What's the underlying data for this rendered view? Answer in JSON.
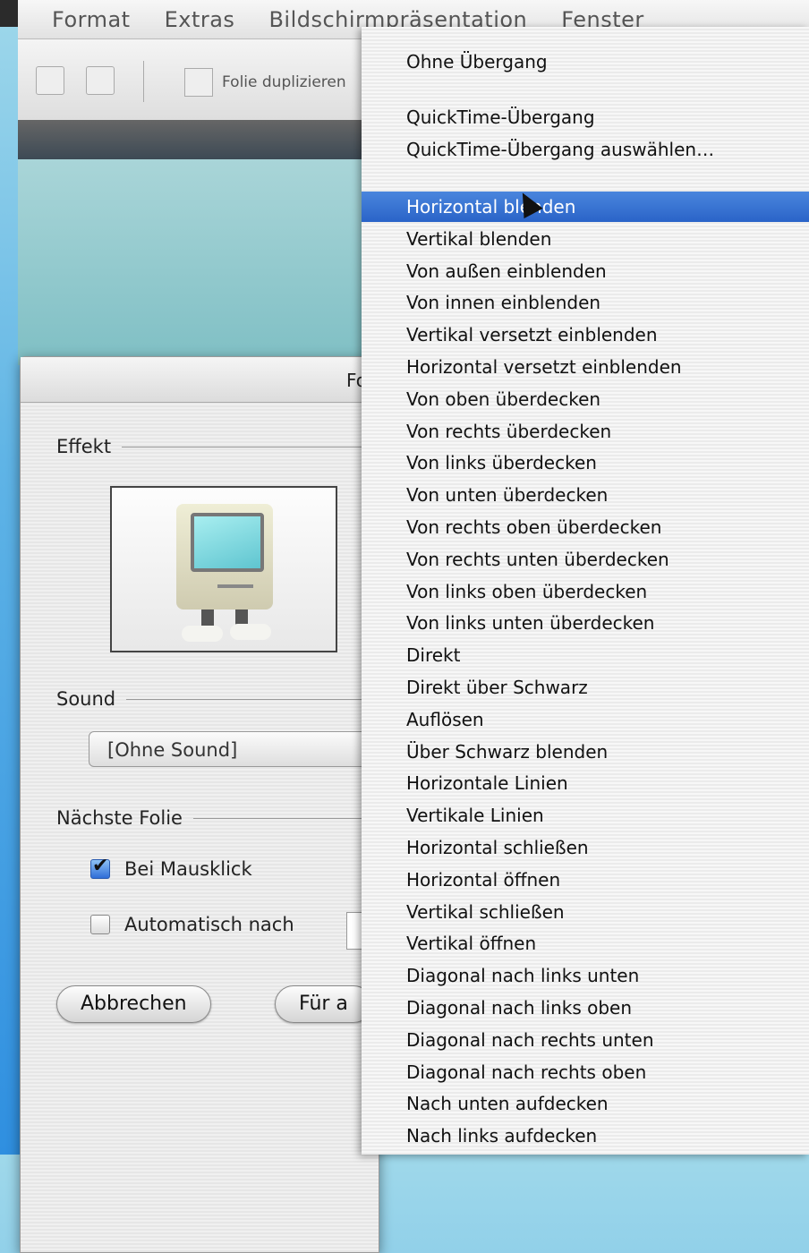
{
  "menubar": {
    "items": [
      "Format",
      "Extras",
      "Bildschirmpräsentation",
      "Fenster"
    ]
  },
  "toolbar": {
    "duplicate_label": "Folie duplizieren"
  },
  "dialog": {
    "title": "Fo",
    "effect_label": "Effekt",
    "sound_label": "Sound",
    "sound_value": "[Ohne Sound]",
    "next_slide_label": "Nächste Folie",
    "on_click_label": "Bei Mausklick",
    "on_click_checked": true,
    "auto_label": "Automatisch nach",
    "auto_checked": false,
    "cancel_label": "Abbrechen",
    "apply_label": "Für a"
  },
  "menu": {
    "items": [
      "Ohne Übergang",
      "QuickTime-Übergang",
      "QuickTime-Übergang auswählen…",
      "Horizontal blenden",
      "Vertikal blenden",
      "Von außen einblenden",
      "Von innen einblenden",
      "Vertikal versetzt einblenden",
      "Horizontal versetzt einblenden",
      "Von oben überdecken",
      "Von rechts überdecken",
      "Von links überdecken",
      "Von unten überdecken",
      "Von rechts oben überdecken",
      "Von rechts unten überdecken",
      "Von links oben überdecken",
      "Von links unten überdecken",
      "Direkt",
      "Direkt über Schwarz",
      "Auflösen",
      "Über Schwarz blenden",
      "Horizontale Linien",
      "Vertikale Linien",
      "Horizontal schließen",
      "Horizontal öffnen",
      "Vertikal schließen",
      "Vertikal öffnen",
      "Diagonal nach links unten",
      "Diagonal nach links oben",
      "Diagonal nach rechts unten",
      "Diagonal nach rechts oben",
      "Nach unten aufdecken",
      "Nach links aufdecken"
    ],
    "selected_index": 3
  },
  "colors": {
    "selection": "#2a63c8",
    "desktop": "#5fb4e6"
  }
}
